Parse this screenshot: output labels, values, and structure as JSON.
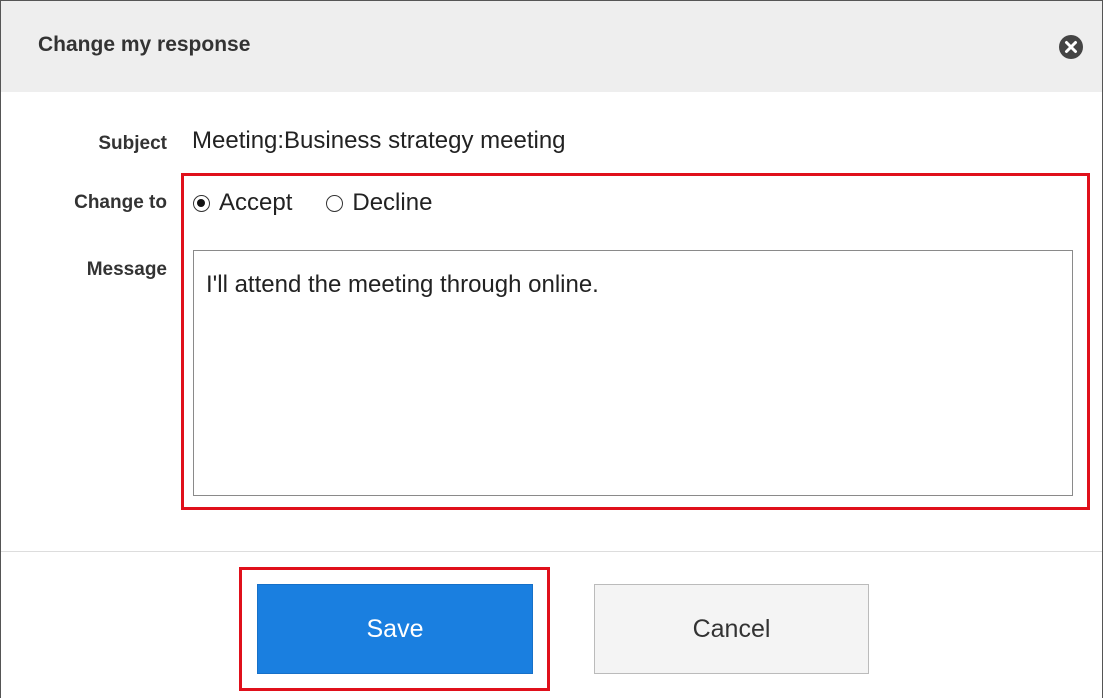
{
  "dialog": {
    "title": "Change my response"
  },
  "form": {
    "subject_label": "Subject",
    "subject_value": "Meeting:Business strategy meeting",
    "change_to_label": "Change to",
    "options": [
      {
        "label": "Accept",
        "checked": true
      },
      {
        "label": "Decline",
        "checked": false
      }
    ],
    "message_label": "Message",
    "message_value": "I'll attend the meeting through online."
  },
  "buttons": {
    "save_label": "Save",
    "cancel_label": "Cancel"
  },
  "colors": {
    "highlight": "#e0101b",
    "save_button": "#1a7fe0",
    "titlebar": "#eeeeee"
  },
  "icons": {
    "close": "close-icon"
  }
}
